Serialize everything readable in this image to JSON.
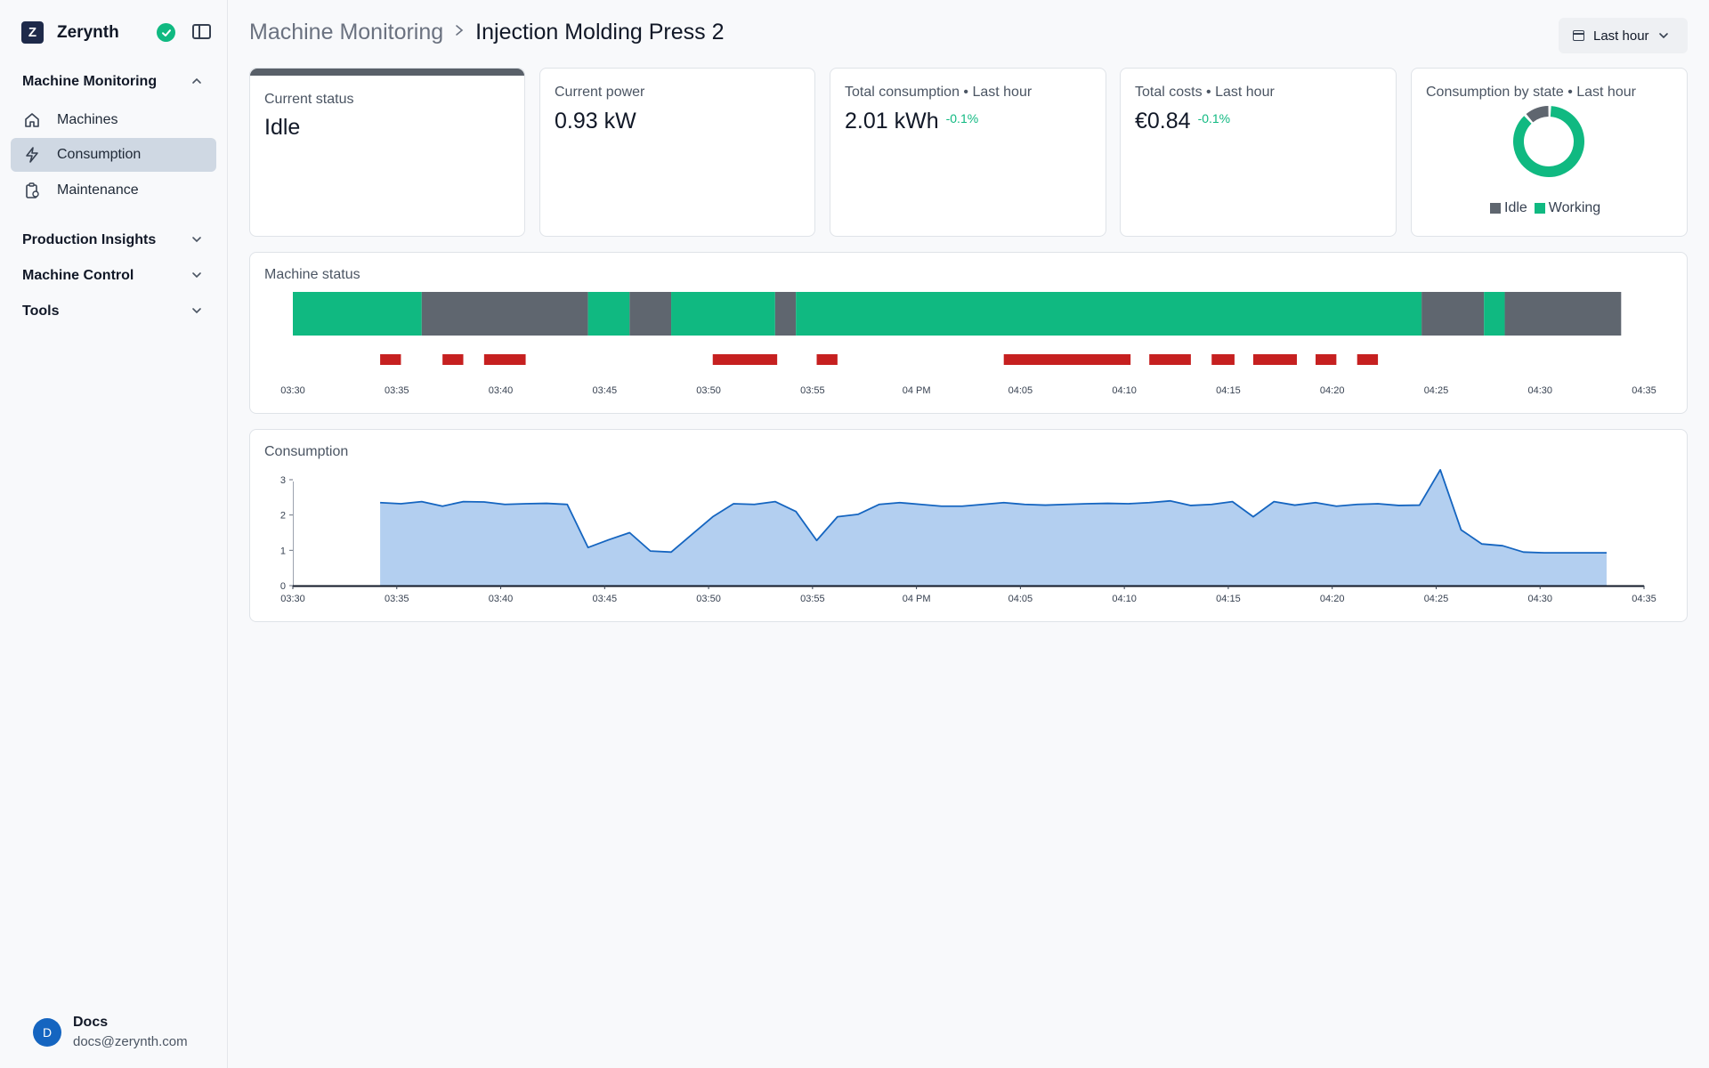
{
  "brand": {
    "name": "Zerynth",
    "logo_letter": "Z"
  },
  "sidebar": {
    "groups": [
      {
        "label": "Machine Monitoring",
        "expanded": true
      },
      {
        "label": "Production Insights",
        "expanded": false
      },
      {
        "label": "Machine Control",
        "expanded": false
      },
      {
        "label": "Tools",
        "expanded": false
      }
    ],
    "items": [
      {
        "label": "Machines",
        "icon": "home-icon",
        "active": false
      },
      {
        "label": "Consumption",
        "icon": "bolt-icon",
        "active": true
      },
      {
        "label": "Maintenance",
        "icon": "clipboard-gear-icon",
        "active": false
      }
    ],
    "user": {
      "initial": "D",
      "name": "Docs",
      "email": "docs@zerynth.com"
    }
  },
  "header": {
    "breadcrumb_parent": "Machine Monitoring",
    "breadcrumb_current": "Injection Molding Press 2",
    "time_range": "Last hour"
  },
  "kpis": {
    "status": {
      "label": "Current status",
      "value": "Idle"
    },
    "power": {
      "label": "Current power",
      "value": "0.93 kW"
    },
    "consumption": {
      "label": "Total consumption • Last hour",
      "value": "2.01 kWh",
      "delta": "-0.1%"
    },
    "costs": {
      "label": "Total costs • Last hour",
      "value": "€0.84",
      "delta": "-0.1%"
    },
    "by_state": {
      "label": "Consumption by state • Last hour",
      "legend_idle": "Idle",
      "legend_working": "Working"
    }
  },
  "colors": {
    "working": "#10b981",
    "idle": "#5f666f",
    "alarm": "#c62020",
    "line": "#1565c0",
    "area": "#b3cff0",
    "positive": "#10b981"
  },
  "status_section": {
    "title": "Machine status"
  },
  "consumption_section": {
    "title": "Consumption"
  },
  "chart_data": [
    {
      "type": "pie",
      "title": "Consumption by state • Last hour",
      "categories": [
        "Idle",
        "Working"
      ],
      "values": [
        12,
        88
      ]
    },
    {
      "type": "timeline",
      "title": "Machine status",
      "x_ticks": [
        "03:30",
        "03:35",
        "03:40",
        "03:45",
        "03:50",
        "03:55",
        "04 PM",
        "04:05",
        "04:10",
        "04:15",
        "04:20",
        "04:25",
        "04:30",
        "04:35"
      ],
      "xlim_minutes": [
        0,
        65
      ],
      "states": [
        {
          "state": "Working",
          "start": 0,
          "end": 6.2
        },
        {
          "state": "Idle",
          "start": 6.2,
          "end": 14.2
        },
        {
          "state": "Working",
          "start": 14.2,
          "end": 16.2
        },
        {
          "state": "Idle",
          "start": 16.2,
          "end": 18.2
        },
        {
          "state": "Working",
          "start": 18.2,
          "end": 23.2
        },
        {
          "state": "Idle",
          "start": 23.2,
          "end": 24.2
        },
        {
          "state": "Working",
          "start": 24.2,
          "end": 54.3
        },
        {
          "state": "Idle",
          "start": 54.3,
          "end": 57.3
        },
        {
          "state": "Working",
          "start": 57.3,
          "end": 58.3
        },
        {
          "state": "Idle",
          "start": 58.3,
          "end": 63.9
        }
      ],
      "alarms": [
        {
          "start": 4.2,
          "end": 5.2
        },
        {
          "start": 7.2,
          "end": 8.2
        },
        {
          "start": 9.2,
          "end": 11.2
        },
        {
          "start": 20.2,
          "end": 23.3
        },
        {
          "start": 25.2,
          "end": 26.2
        },
        {
          "start": 34.2,
          "end": 40.3
        },
        {
          "start": 41.2,
          "end": 43.2
        },
        {
          "start": 44.2,
          "end": 45.3
        },
        {
          "start": 46.2,
          "end": 48.3
        },
        {
          "start": 49.2,
          "end": 50.2
        },
        {
          "start": 51.2,
          "end": 52.2
        }
      ]
    },
    {
      "type": "area",
      "title": "Consumption",
      "x_ticks": [
        "03:30",
        "03:35",
        "03:40",
        "03:45",
        "03:50",
        "03:55",
        "04 PM",
        "04:05",
        "04:10",
        "04:15",
        "04:20",
        "04:25",
        "04:30",
        "04:35"
      ],
      "xlim_minutes": [
        0,
        65
      ],
      "ylim": [
        0,
        3.3
      ],
      "y_ticks": [
        0,
        1,
        2,
        3
      ],
      "x": [
        4.2,
        5.2,
        6.2,
        7.2,
        8.2,
        9.2,
        10.2,
        11.2,
        12.2,
        13.2,
        14.2,
        15.2,
        16.2,
        17.2,
        18.2,
        19.2,
        20.2,
        21.2,
        22.2,
        23.2,
        24.2,
        25.2,
        26.2,
        27.2,
        28.2,
        29.2,
        30.2,
        31.2,
        32.2,
        33.2,
        34.2,
        35.2,
        36.2,
        37.2,
        38.2,
        39.2,
        40.2,
        41.2,
        42.2,
        43.2,
        44.2,
        45.2,
        46.2,
        47.2,
        48.2,
        49.2,
        50.2,
        51.2,
        52.2,
        53.2,
        54.2,
        55.2,
        56.2,
        57.2,
        58.2,
        59.2,
        60.2,
        61.2,
        62.2,
        63.2
      ],
      "y": [
        2.35,
        2.32,
        2.38,
        2.25,
        2.38,
        2.37,
        2.3,
        2.32,
        2.33,
        2.3,
        1.08,
        1.3,
        1.5,
        0.98,
        0.95,
        1.45,
        1.95,
        2.32,
        2.3,
        2.38,
        2.1,
        1.28,
        1.95,
        2.02,
        2.3,
        2.35,
        2.3,
        2.25,
        2.25,
        2.3,
        2.35,
        2.3,
        2.28,
        2.3,
        2.32,
        2.33,
        2.32,
        2.35,
        2.4,
        2.27,
        2.3,
        2.38,
        1.95,
        2.38,
        2.28,
        2.35,
        2.25,
        2.3,
        2.32,
        2.27,
        2.28,
        3.28,
        1.58,
        1.18,
        1.13,
        0.95,
        0.93,
        0.93,
        0.93,
        0.93
      ]
    }
  ]
}
